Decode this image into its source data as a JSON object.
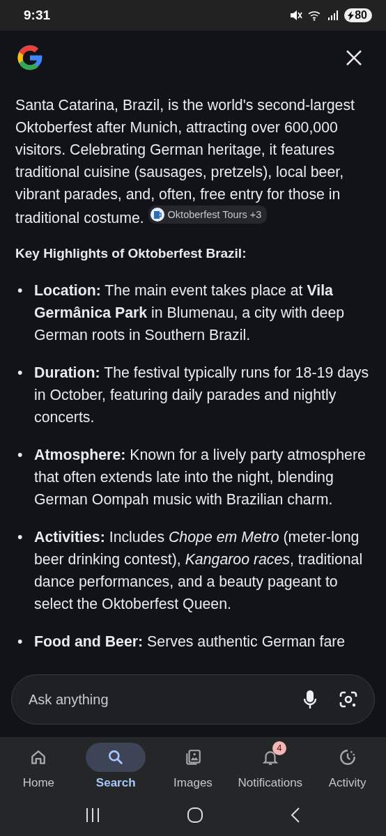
{
  "status_bar": {
    "time": "9:31",
    "battery": "80"
  },
  "answer": {
    "intro": "Santa Catarina, Brazil, is the world's second-largest Oktoberfest after Munich, attracting over 600,000 visitors. Celebrating German heritage, it features traditional cuisine (sausages, pretzels), local beer, vibrant parades, and, often, free entry for those in traditional costume.",
    "source_chip": "Oktoberfest Tours +3",
    "heading": "Key Highlights of Oktoberfest Brazil:",
    "bullets": [
      {
        "marker": "•",
        "text": "**Location:** The main event takes place at **Vila Germânica Park** in Blumenau, a city with deep German roots in Southern Brazil."
      },
      {
        "marker": "•",
        "text": "**Duration:** The festival typically runs for 18-19 days in October, featuring daily parades and nightly concerts."
      },
      {
        "marker": "•",
        "text": "**Atmosphere:** Known for a lively party atmosphere that often extends late into the night, blending German Oompah music with Brazilian charm."
      },
      {
        "marker": "•",
        "text": "**Activities:** Includes *Chope em Metro* (meter-long beer drinking contest), *Kangaroo races*, traditional dance performances, and a beauty pageant to select the Oktoberfest Queen."
      },
      {
        "marker": "•",
        "text": "**Food and Beer:** Serves authentic German fare"
      }
    ]
  },
  "search": {
    "placeholder": "Ask anything"
  },
  "nav": [
    {
      "label": "Home",
      "selected": false
    },
    {
      "label": "Search",
      "selected": true
    },
    {
      "label": "Images",
      "selected": false
    },
    {
      "label": "Notifications",
      "selected": false,
      "badge": "4"
    },
    {
      "label": "Activity",
      "selected": false
    }
  ]
}
